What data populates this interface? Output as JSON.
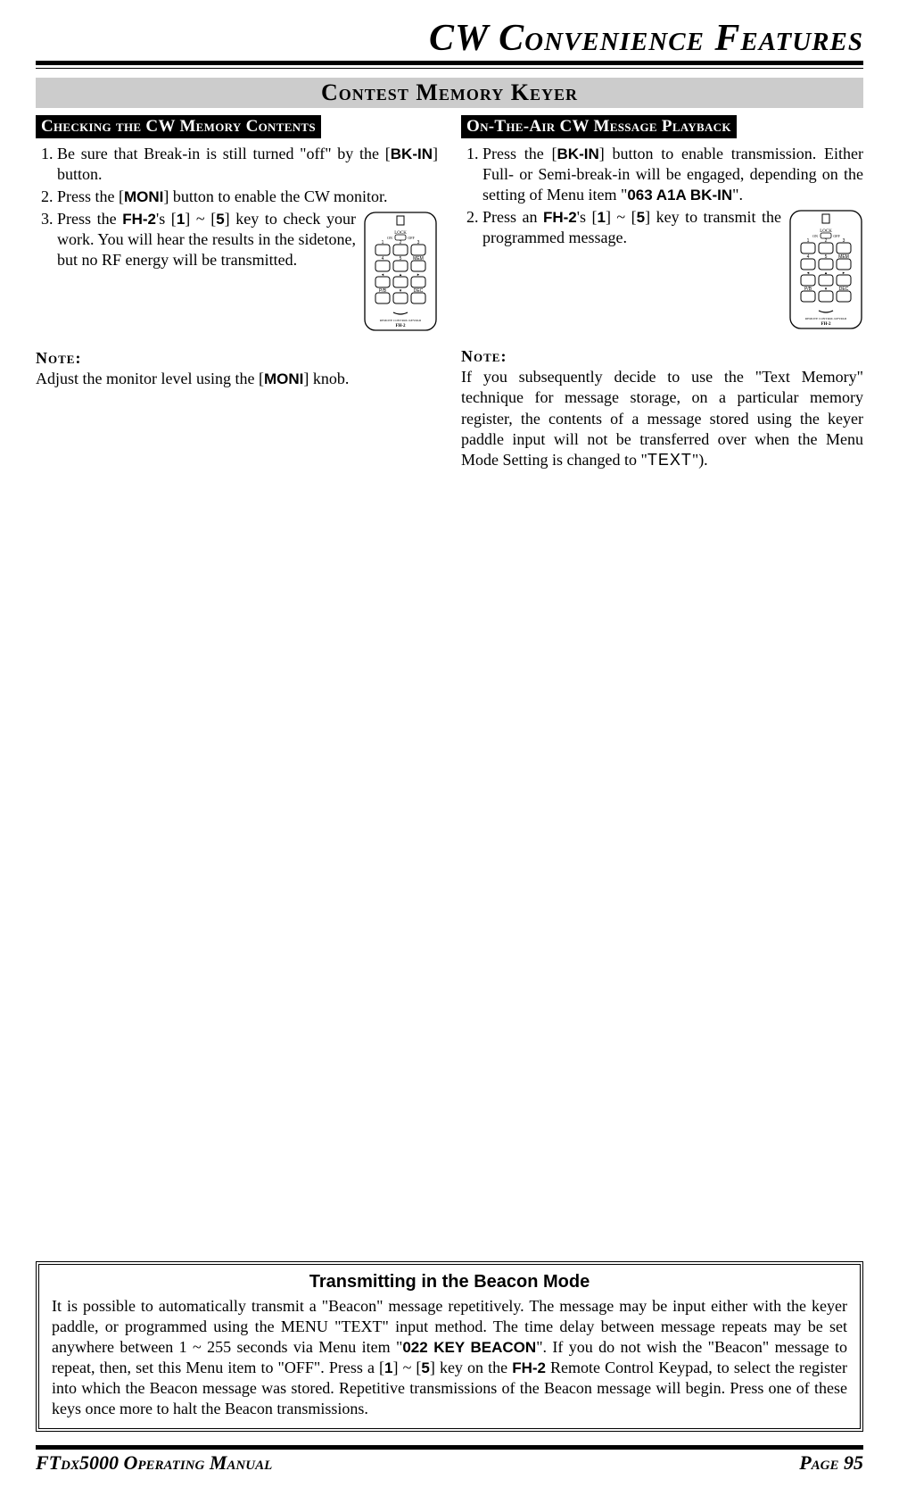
{
  "header": {
    "title": "CW Convenience Features"
  },
  "section": {
    "heading": "Contest Memory Keyer"
  },
  "left": {
    "subhead": "Checking the CW Memory Contents",
    "step1_a": "Be sure that Break-in is still turned \"off\" by the [",
    "step1_b": "BK-IN",
    "step1_c": "] button.",
    "step2_a": "Press the [",
    "step2_b": "MONI",
    "step2_c": "] button to enable the CW monitor.",
    "step3_a": "Press the ",
    "step3_b": "FH-2",
    "step3_c": "'s [",
    "step3_d": "1",
    "step3_e": "] ~ [",
    "step3_f": "5",
    "step3_g": "] key to check your work. You will hear the results in the sidetone, but no RF energy will be transmitted.",
    "note_label": "Note:",
    "note_a": "Adjust the monitor level using the [",
    "note_b": "MONI",
    "note_c": "] knob."
  },
  "right": {
    "subhead": "On-The-Air CW Message Playback",
    "step1_a": "Press the [",
    "step1_b": "BK-IN",
    "step1_c": "] button to enable transmission. Either Full- or Semi-break-in will be engaged, depending on the setting of Menu item \"",
    "step1_d": "063 A1A BK-IN",
    "step1_e": "\".",
    "step2_a": "Press an ",
    "step2_b": "FH-2",
    "step2_c": "'s [",
    "step2_d": "1",
    "step2_e": "] ~ [",
    "step2_f": "5",
    "step2_g": "] key to transmit the programmed message.",
    "note_label": "Note:",
    "note_body_a": "If you subsequently decide to use the \"Text Memory\" technique for message storage, on a particular memory register, the contents of a message stored using the keyer paddle input will not be transferred over when the Menu Mode Setting is changed to \"",
    "note_body_b": "TEXT",
    "note_body_c": "\")."
  },
  "beacon": {
    "title": "Transmitting in the Beacon Mode",
    "body_a": "It is possible to automatically transmit a \"Beacon\" message repetitively. The message may be input either with the keyer paddle, or programmed using the MENU \"TEXT\" input method. The time delay between message repeats may be set anywhere between 1 ~ 255 seconds via Menu item \"",
    "body_b": "022 KEY BEACON",
    "body_c": "\". If you do not wish the \"Beacon\" message to repeat, then, set this Menu item to \"OFF\". Press a [",
    "body_d": "1",
    "body_e": "] ~ [",
    "body_f": "5",
    "body_g": "] key on the ",
    "body_h": "FH-2",
    "body_i": " Remote Control Keypad, to select  the register into which the Beacon message was stored. Repetitive transmissions of the Beacon message will begin. Press one of these keys once more to halt the Beacon transmissions."
  },
  "footer": {
    "left": "FTdx5000 Operating Manual",
    "right": "Page 95"
  },
  "keypad": {
    "label_lock": "LOCK",
    "label_on": "ON",
    "label_off": "OFF",
    "k1": "1",
    "k2": "2",
    "k3": "3",
    "k4": "4",
    "k5": "5",
    "kmem": "MEM",
    "kleft": "◂",
    "kup": "▴",
    "kright": "▸",
    "kpb": "P/B",
    "kdown": "▾",
    "kdec": "DEC",
    "brand": "REMOTE CONTROL KEYPAD",
    "model": "FH-2"
  }
}
